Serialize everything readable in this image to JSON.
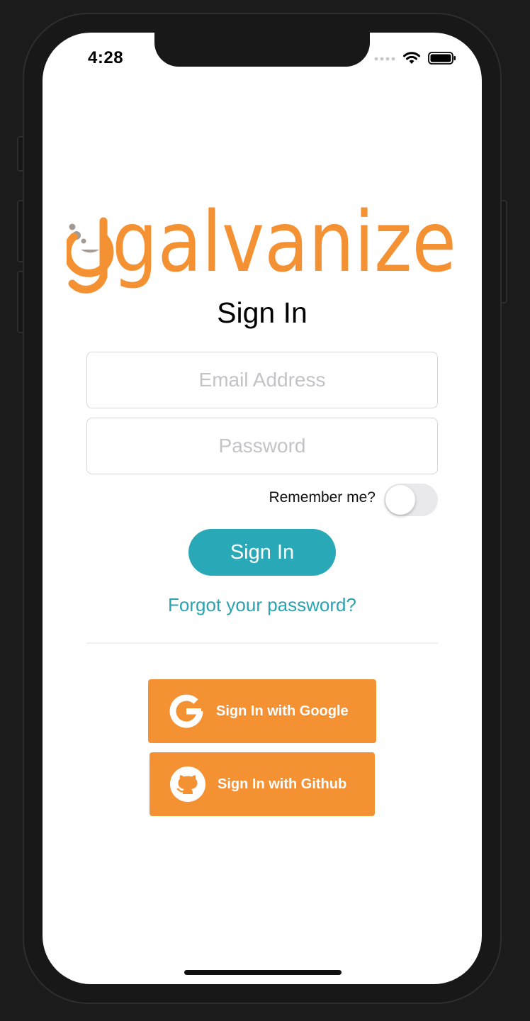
{
  "status_bar": {
    "time": "4:28"
  },
  "logo": {
    "text": "galvanize",
    "color": "#f39133"
  },
  "title": "Sign In",
  "email": {
    "placeholder": "Email Address",
    "value": ""
  },
  "password": {
    "placeholder": "Password",
    "value": ""
  },
  "remember": {
    "label": "Remember me?",
    "on": false
  },
  "signin_button": {
    "label": "Sign In"
  },
  "forgot_link": {
    "label": "Forgot your password?"
  },
  "social": [
    {
      "label": "Sign In with Google",
      "icon": "google-icon"
    },
    {
      "label": "Sign In with Github",
      "icon": "github-icon"
    }
  ],
  "colors": {
    "brand_orange": "#f39133",
    "accent_teal": "#29a8b7"
  }
}
